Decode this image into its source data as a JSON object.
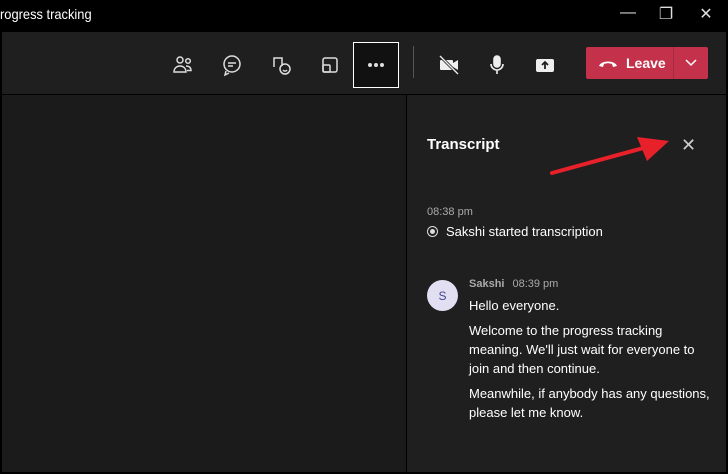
{
  "window": {
    "title": "rogress tracking",
    "minimize": "—",
    "maximize": "❐",
    "close": "✕"
  },
  "toolbar": {
    "leave_label": "Leave"
  },
  "transcript": {
    "title": "Transcript",
    "close": "✕",
    "event_time": "08:38 pm",
    "event_text": "Sakshi started transcription",
    "messages": [
      {
        "avatar": "S",
        "author": "Sakshi",
        "time": "08:39 pm",
        "paragraphs": [
          "Hello everyone.",
          "Welcome to the progress tracking meaning. We'll just wait for everyone to join and then continue.",
          "Meanwhile, if anybody has any questions, please let me know."
        ]
      }
    ]
  },
  "colors": {
    "leave": "#c4314b",
    "arrow": "#e8202a"
  }
}
